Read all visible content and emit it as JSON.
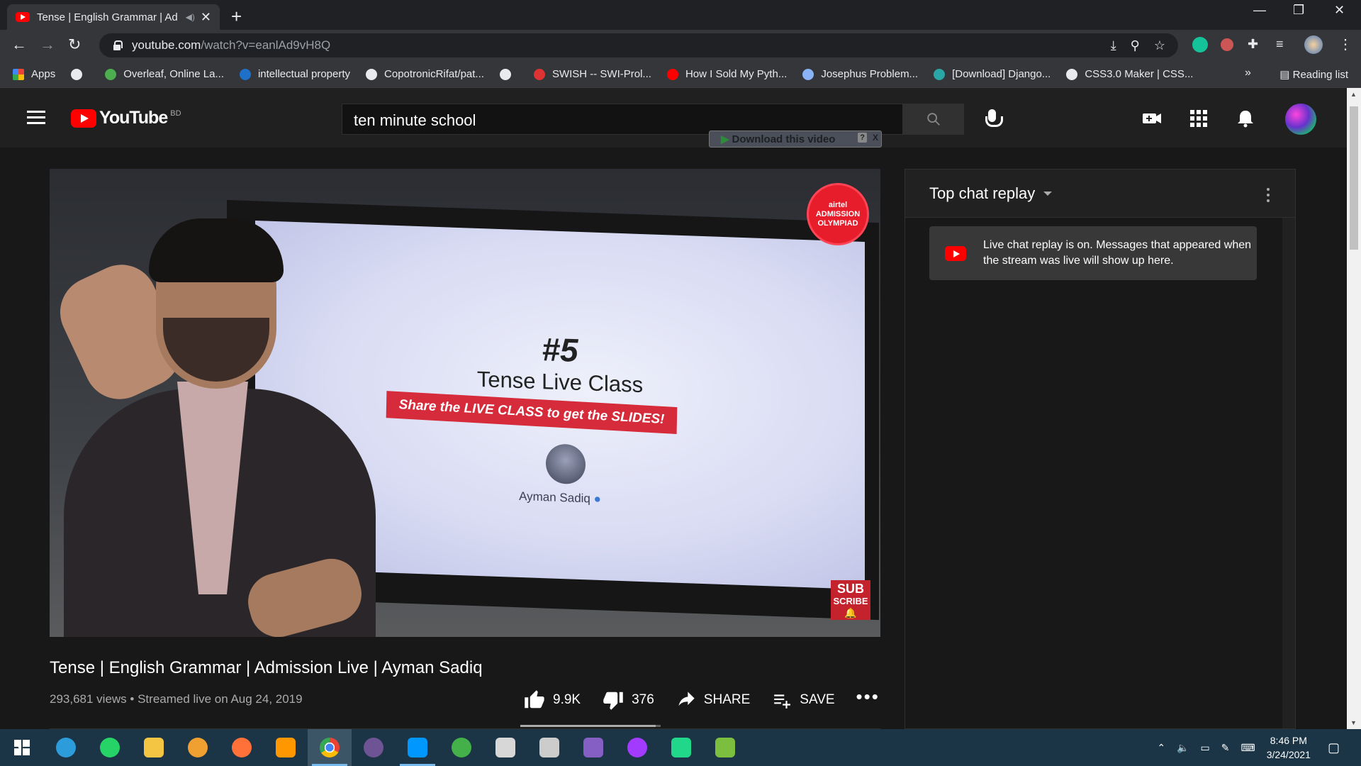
{
  "browser": {
    "tab_title": "Tense | English Grammar | Ad",
    "new_tab": "+",
    "url_host": "youtube.com",
    "url_path": "/watch?v=eanlAd9vH8Q",
    "bookmarks": [
      {
        "label": "Apps",
        "icon": "apps-grid-icon",
        "color": "#e8eaed"
      },
      {
        "label": "",
        "icon": "globe-icon",
        "color": "#e8eaed"
      },
      {
        "label": "Overleaf, Online La...",
        "icon": "overleaf-icon",
        "color": "#4cae4f"
      },
      {
        "label": "intellectual property",
        "icon": "scribd-icon",
        "color": "#1e70c8"
      },
      {
        "label": "CopotronicRifat/pat...",
        "icon": "github-icon",
        "color": "#e8eaed"
      },
      {
        "label": "",
        "icon": "globe-icon",
        "color": "#e8eaed"
      },
      {
        "label": "SWISH -- SWI-Prol...",
        "icon": "swi-prolog-icon",
        "color": "#d33"
      },
      {
        "label": "How I Sold My Pyth...",
        "icon": "youtube-icon",
        "color": "#f00"
      },
      {
        "label": "Josephus Problem...",
        "icon": "loading-icon",
        "color": "#8ab4f8"
      },
      {
        "label": "[Download] Django...",
        "icon": "site-icon",
        "color": "#2aa6a6"
      },
      {
        "label": "CSS3.0 Maker | CSS...",
        "icon": "globe-icon",
        "color": "#e8eaed"
      }
    ],
    "more_bookmarks": "»",
    "reading_list": "Reading list"
  },
  "youtube": {
    "logo_text": "YouTube",
    "country_code": "BD",
    "search_value": "ten minute school",
    "download_bar": "Download this video",
    "download_help": "?",
    "download_close": "X"
  },
  "video": {
    "screen_number": "#5",
    "screen_title": "Tense Live Class",
    "screen_banner": "Share the LIVE CLASS to get the SLIDES!",
    "screen_name": "Ayman Sadiq",
    "badge_lines": [
      "airtel",
      "ADMISSION",
      "OLYMPIAD"
    ],
    "subscribe_lines": [
      "SUB",
      "SCRIBE"
    ],
    "title": "Tense | English Grammar | Admission Live | Ayman Sadiq",
    "views": "293,681 views",
    "streamed": "Streamed live on Aug 24, 2019",
    "likes": "9.9K",
    "dislikes": "376",
    "share_label": "SHARE",
    "save_label": "SAVE",
    "like_ratio": 0.963
  },
  "chat": {
    "header": "Top chat replay",
    "message": "Live chat replay is on. Messages that appeared when the stream was live will show up here."
  },
  "taskbar": {
    "apps": [
      {
        "icon": "windows-start-icon",
        "color": "#ffffff"
      },
      {
        "icon": "cortana-icon",
        "color": "#2d9cdb"
      },
      {
        "icon": "whatsapp-icon",
        "color": "#25d366"
      },
      {
        "icon": "file-explorer-icon",
        "color": "#f4c542"
      },
      {
        "icon": "tor-browser-icon",
        "color": "#f0a030"
      },
      {
        "icon": "firefox-icon",
        "color": "#ff7139"
      },
      {
        "icon": "sublime-text-icon",
        "color": "#ff9800"
      },
      {
        "icon": "chrome-icon",
        "color": "#34a853"
      },
      {
        "icon": "github-desktop-icon",
        "color": "#6e5494"
      },
      {
        "icon": "vscode-icon",
        "color": "#0098ff"
      },
      {
        "icon": "anaconda-icon",
        "color": "#43b049"
      },
      {
        "icon": "swi-prolog-icon",
        "color": "#d7d7d7"
      },
      {
        "icon": "inkscape-icon",
        "color": "#cccccc"
      },
      {
        "icon": "visual-studio-icon",
        "color": "#865fc5"
      },
      {
        "icon": "messenger-icon",
        "color": "#a33bff"
      },
      {
        "icon": "pycharm-icon",
        "color": "#21d789"
      },
      {
        "icon": "notepad-icon",
        "color": "#7cbf3e"
      }
    ],
    "time": "8:46 PM",
    "date": "3/24/2021"
  }
}
